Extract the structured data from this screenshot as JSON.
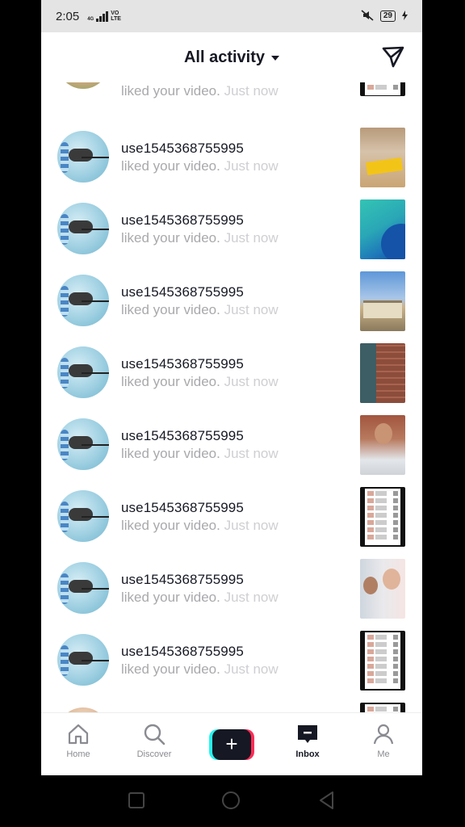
{
  "status_bar": {
    "time": "2:05",
    "network_top": "4G",
    "network_bottom": "VO LTE",
    "battery": "29"
  },
  "header": {
    "title": "All activity"
  },
  "activity": {
    "partial_top_text": "liked your video.",
    "partial_top_time": "Just now",
    "items": [
      {
        "username": "use1545368755995",
        "text": "liked your video.",
        "time": "Just now",
        "thumbnail": "person-yellow-tag"
      },
      {
        "username": "use1545368755995",
        "text": "liked your video.",
        "time": "Just now",
        "thumbnail": "teal-abstract"
      },
      {
        "username": "use1545368755995",
        "text": "liked your video.",
        "time": "Just now",
        "thumbnail": "building-sky"
      },
      {
        "username": "use1545368755995",
        "text": "liked your video.",
        "time": "Just now",
        "thumbnail": "brick-wall"
      },
      {
        "username": "use1545368755995",
        "text": "liked your video.",
        "time": "Just now",
        "thumbnail": "man-portrait"
      },
      {
        "username": "use1545368755995",
        "text": "liked your video.",
        "time": "Just now",
        "thumbnail": "app-screenshot"
      },
      {
        "username": "use1545368755995",
        "text": "liked your video.",
        "time": "Just now",
        "thumbnail": "two-people"
      },
      {
        "username": "use1545368755995",
        "text": "liked your video.",
        "time": "Just now",
        "thumbnail": "app-screenshot"
      }
    ]
  },
  "bottom_nav": {
    "home": "Home",
    "discover": "Discover",
    "create": "+",
    "inbox": "Inbox",
    "me": "Me"
  },
  "colors": {
    "text_primary": "#161823",
    "text_secondary": "#a9a9ad",
    "accent_cyan": "#25f4ee",
    "accent_pink": "#fe2c55"
  }
}
